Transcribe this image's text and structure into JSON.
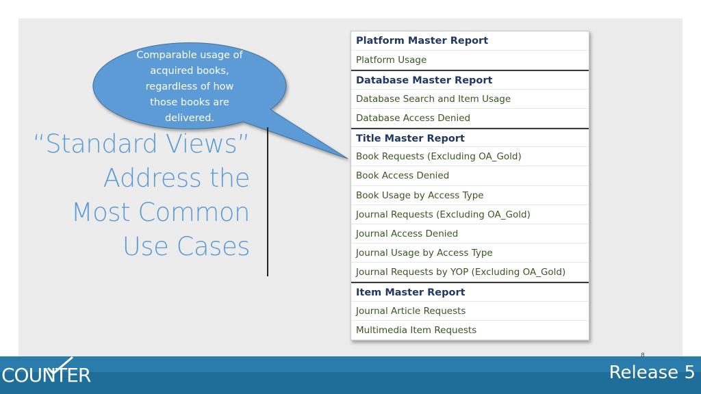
{
  "callout": {
    "text_lines": [
      "Comparable usage of",
      "acquired books,",
      "regardless of how",
      "those books are",
      "delivered."
    ]
  },
  "title": {
    "lines": [
      "“Standard Views”",
      "Address the",
      "Most Common",
      "Use Cases"
    ]
  },
  "report_table": [
    {
      "kind": "header",
      "text": "Platform Master Report"
    },
    {
      "kind": "item",
      "text": "Platform Usage"
    },
    {
      "kind": "header",
      "text": "Database Master Report"
    },
    {
      "kind": "item",
      "text": "Database Search and Item Usage"
    },
    {
      "kind": "item",
      "text": "Database Access Denied"
    },
    {
      "kind": "header",
      "text": "Title Master Report"
    },
    {
      "kind": "item",
      "text": "Book Requests (Excluding OA_Gold)"
    },
    {
      "kind": "item",
      "text": "Book Access Denied"
    },
    {
      "kind": "item",
      "text": "Book Usage by Access Type"
    },
    {
      "kind": "item",
      "text": "Journal Requests (Excluding OA_Gold)"
    },
    {
      "kind": "item",
      "text": "Journal Access Denied"
    },
    {
      "kind": "item",
      "text": "Journal Usage by Access Type"
    },
    {
      "kind": "item",
      "text": "Journal Requests by YOP (Excluding OA_Gold)"
    },
    {
      "kind": "header",
      "text": "Item Master Report"
    },
    {
      "kind": "item",
      "text": "Journal Article Requests"
    },
    {
      "kind": "item",
      "text": "Multimedia Item Requests"
    }
  ],
  "footer": {
    "logo_text": "COUNTER",
    "release_label": "Release 5",
    "page_number": "8"
  },
  "colors": {
    "title": "#5b9bd5",
    "bubble": "#5b9bd5",
    "header_text": "#203864",
    "item_text": "#385723",
    "footer": "#1f6d99"
  },
  "icons": {
    "logo_mark": "checkmark-icon"
  }
}
